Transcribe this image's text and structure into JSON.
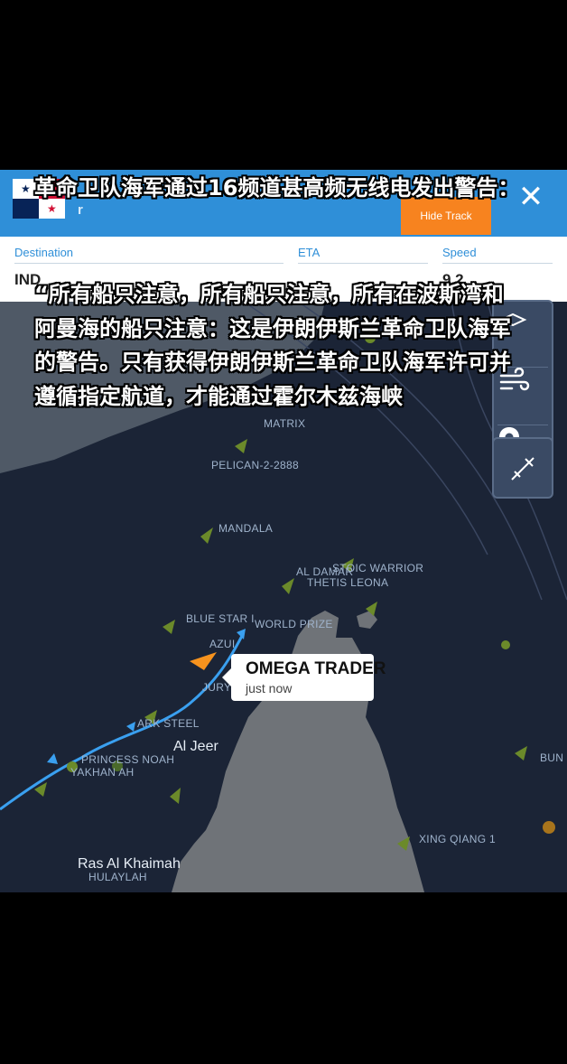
{
  "header": {
    "vessel_subtitle": "r",
    "hide_track_label": "Hide Track",
    "close_icon": "close-icon"
  },
  "info": {
    "destination_label": "Destination",
    "destination_value": "IND",
    "eta_label": "ETA",
    "speed_label": "Speed",
    "speed_value": "9.2"
  },
  "map_labels": {
    "pelican": "PELICAN-2-2888",
    "mandala": "MANDALA",
    "al_damar": "AL DAMAR",
    "stoic_warrior": "STOIC WARRIOR",
    "thetis_leona": "THETIS LEONA",
    "blue_star": "BLUE STAR I",
    "world_prize": "WORLD PRIZE",
    "azur": "AZUI",
    "jury": "JURY",
    "ark_steel": "ARK STEEL",
    "princess_noah": "PRINCESS NOAH",
    "yakhanah": "YAKHAN AH",
    "xing_qiang": "XING QIANG 1",
    "bun": "BUN",
    "hulaylah": "HULAYLAH",
    "matrix": "MATRIX"
  },
  "places": {
    "al_jeer": "Al Jeer",
    "ras_al_khaimah": "Ras Al Khaimah"
  },
  "callout": {
    "vessel_name": "OMEGA TRADER",
    "time": "just now"
  },
  "captions": {
    "line1": "革命卫队海军通过16频道甚高频无线电发出警告：",
    "line2": "“所有船只注意，所有船只注意，所有在波斯湾和阿曼海的船只注意：这是伊朗伊斯兰革命卫队海军的警告。只有获得伊朗伊斯兰革命卫队海军许可并遵循指定航道，才能通过霍尔木兹海峡"
  },
  "colors": {
    "header_blue": "#2f8fd8",
    "hide_track_orange": "#f7831f",
    "sea": "#1b2436",
    "land": "#6f7378",
    "track": "#3aa0f0"
  },
  "controls": [
    "wind-icon",
    "location-pin-icon",
    "measure-icon"
  ]
}
